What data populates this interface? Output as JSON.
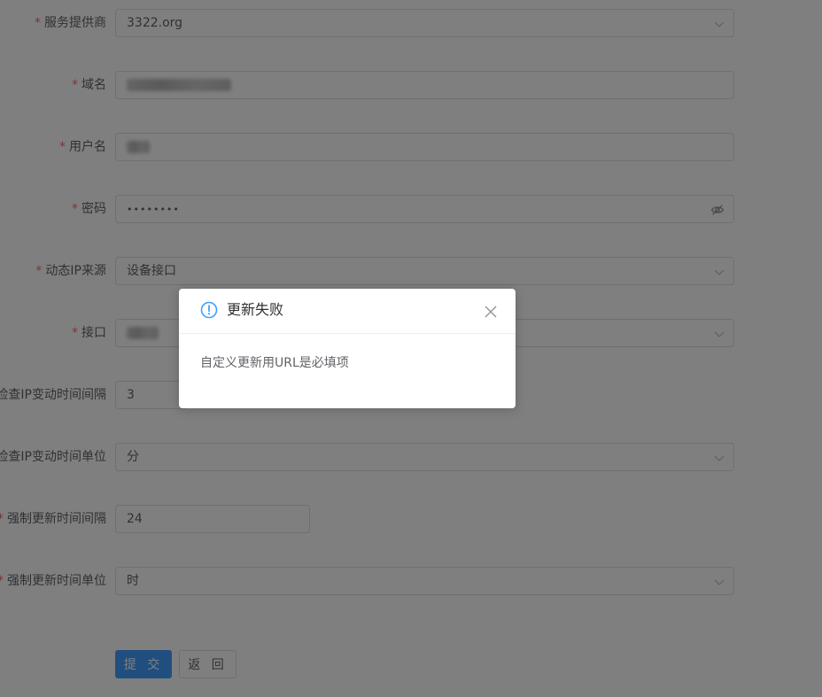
{
  "form": {
    "provider": {
      "label": "服务提供商",
      "value": "3322.org"
    },
    "domain": {
      "label": "域名"
    },
    "username": {
      "label": "用户名"
    },
    "password": {
      "label": "密码",
      "value": "••••••••"
    },
    "ip_source": {
      "label": "动态IP来源",
      "value": "设备接口"
    },
    "interface": {
      "label": "接口"
    },
    "check_interval": {
      "label": "检查IP变动时间间隔",
      "value": "3"
    },
    "check_unit": {
      "label": "检查IP变动时间单位",
      "value": "分"
    },
    "force_interval": {
      "label": "强制更新时间间隔",
      "value": "24"
    },
    "force_unit": {
      "label": "强制更新时间单位",
      "value": "时"
    }
  },
  "buttons": {
    "submit": "提 交",
    "back": "返 回"
  },
  "dialog": {
    "title": "更新失败",
    "message": "自定义更新用URL是必填项"
  },
  "colors": {
    "required": "#f56c6c",
    "primary": "#409eff",
    "info_icon": "#409eff"
  },
  "icons": {
    "select_arrow": "chevron-down-icon",
    "password_toggle": "eye-off-icon",
    "dialog_info": "info-circle-icon",
    "dialog_close": "close-icon"
  }
}
